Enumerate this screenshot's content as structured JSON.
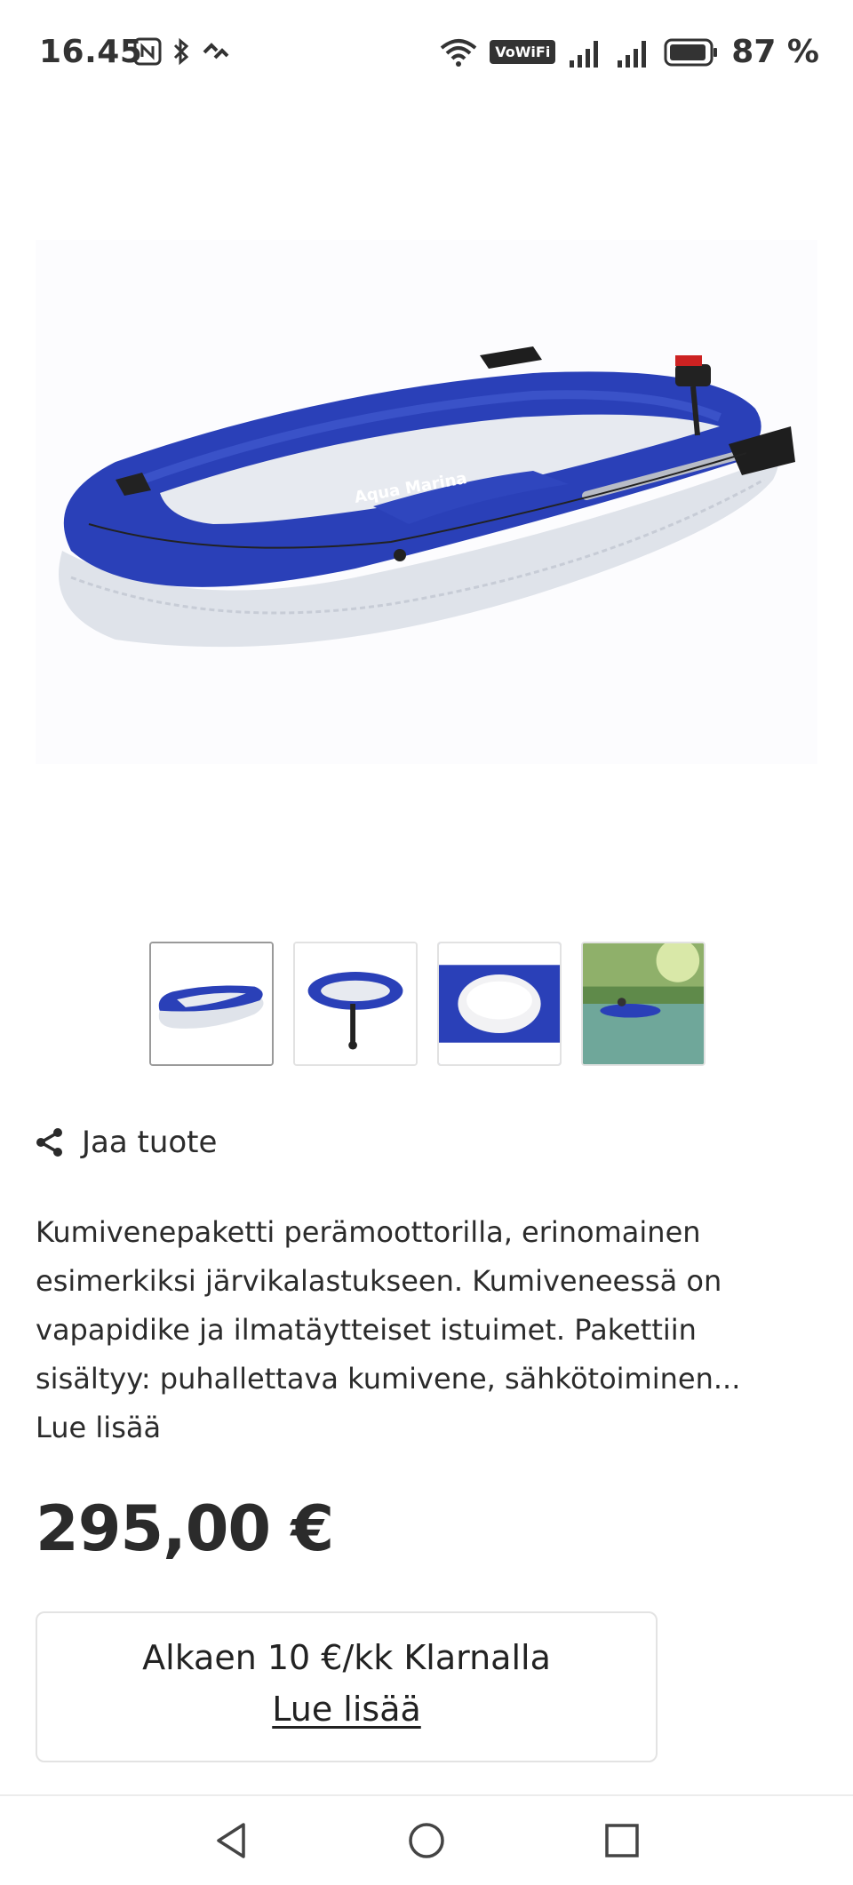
{
  "status_bar": {
    "time": "16.45",
    "vowifi": "VoWiFi",
    "battery": "87 %",
    "icons": [
      "nfc-icon",
      "bluetooth-icon",
      "link-icon",
      "wifi-icon",
      "vowifi-icon",
      "signal-icon",
      "signal-icon",
      "battery-icon"
    ]
  },
  "product": {
    "image_alt": "inflatable-boat",
    "thumbnails": [
      {
        "name": "thumbnail-boat-side",
        "active": true
      },
      {
        "name": "thumbnail-boat-motor",
        "active": false
      },
      {
        "name": "thumbnail-seat-cushion",
        "active": false
      },
      {
        "name": "thumbnail-boat-on-lake",
        "active": false
      }
    ],
    "share_label": "Jaa tuote",
    "description": "Kumivenepaketti perämoottorilla, erinomainen esimerkiksi järvikalastukseen. Kumiveneessä on vapapidike ja ilmatäytteiset istuimet. Pakettiin sisältyy: puhallettava kumivene, sähkötoiminen...",
    "read_more": "Lue lisää",
    "price": "295,00 €"
  },
  "klarna": {
    "text": "Alkaen 10 €/kk Klarnalla",
    "link": "Lue lisää"
  },
  "colors": {
    "boat_blue": "#2a40b8",
    "boat_grey": "#dfe3ea",
    "text": "#2b2b2b"
  }
}
